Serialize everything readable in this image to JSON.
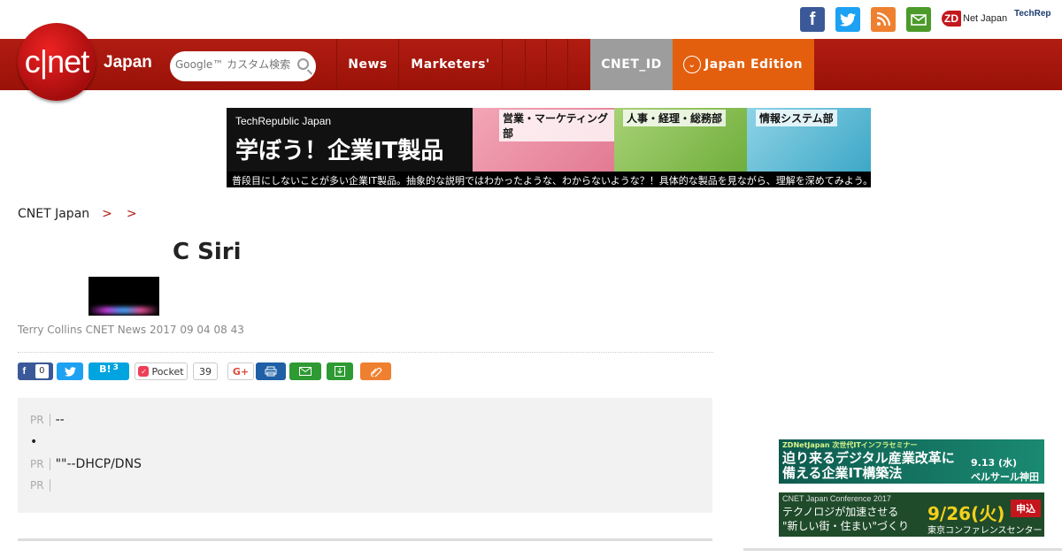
{
  "social": {
    "facebook_icon": "f",
    "twitter_icon": "twitter-bird",
    "rss_icon": "rss",
    "mail_icon": "envelope",
    "zdnet_label": "ZD",
    "zdnet_suffix": "Net Japan",
    "techrepublic_label": "TechRep"
  },
  "nav": {
    "logo_text": "c|net",
    "japan_label": "Japan",
    "search_placeholder": "Google™ カスタム検索",
    "news": "News",
    "marketers": "Marketers'",
    "sep1": "",
    "sep2": "",
    "sep3": "",
    "sep4": "",
    "cnet_id": "CNET_ID",
    "edition": "Japan Edition"
  },
  "banner": {
    "brand": "TechRepublic Japan",
    "headline": "学ぼう！企業IT製品",
    "panel1": "営業・マーケティング部",
    "panel2": "人事・経理・総務部",
    "panel3": "情報システム部",
    "tagline": "普段目にしないことが多い企業IT製品。抽象的な説明ではわかったような、わからないような？！具体的な製品を見ながら、理解を深めてみよう。"
  },
  "breadcrumb": {
    "home": "CNET Japan",
    "sep": ">",
    "level1": "",
    "level2": ""
  },
  "article": {
    "title": "C Siri",
    "byline": "Terry Collins  CNET News   2017 09 04  08 43 "
  },
  "share": {
    "fb_count": "0",
    "hatena_label": "B!",
    "hatena_count": "3",
    "pocket_label": "Pocket",
    "pocket_count": "39",
    "gplus_label": "G+"
  },
  "pr": {
    "tag": "PR",
    "row1": "--",
    "row2": "",
    "row3": "\"\"--DHCP/DNS",
    "row4": ""
  },
  "ads": {
    "ad1_small": "ZDNetJapan 次世代ITインフラセミナー",
    "ad1_line1": "迫り来るデジタル産業改革に",
    "ad1_line2": "備える企業IT構築法",
    "ad1_date": "9.13 (水)",
    "ad1_venue": "ベルサール神田",
    "ad2_small": "CNET Japan Conference 2017",
    "ad2_line1": "テクノロジが加速させる",
    "ad2_line2": "\"新しい街・住まい\"づくり",
    "ad2_date": "9/26(火)",
    "ad2_venue": "東京コンファレンスセンター",
    "ad2_apply": "申込"
  }
}
